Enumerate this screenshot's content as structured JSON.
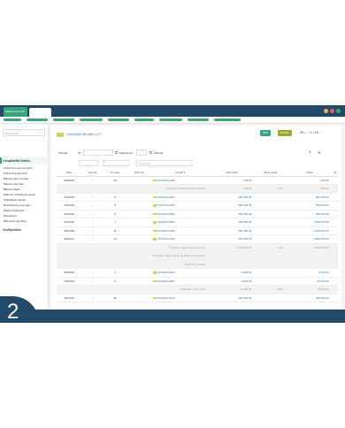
{
  "window": {
    "tab_label": "Tableau de bord",
    "dot_colors": [
      "#e8b64c",
      "#e55e5e",
      "#3aa57a"
    ]
  },
  "menu": {
    "pill_color": "#3aa57a"
  },
  "sidebar": {
    "search_placeholder": "Rechercher",
    "search_clear": "×",
    "section_accounting": "Comptabilité Détailé...",
    "items": [
      "Grand livre des comptes",
      "Grand livre des tiers",
      "Balance des comptes",
      "Balance des tiers",
      "Balance Agée",
      "Etats de contrôle de caisse",
      "Statistiques clients",
      "Brouillard des journaux",
      "Rapport d'activité",
      "Echéancier",
      "Bilan actif reporting"
    ],
    "section_config": "Configuration"
  },
  "header": {
    "title": "Grand livre des tiers",
    "count": "(437)",
    "pdf": "PDF",
    "excel": "EXCEL",
    "per_page": "25 ⌄",
    "page": "1",
    "of": "/ 19",
    "prev": "‹",
    "next": "›"
  },
  "filters": {
    "period_label": "Période",
    "from_label": "Du",
    "lettered_from": "Marqué Au",
    "lettered": "Marqué",
    "search_icon": "search-icon",
    "reset_icon": "reset-icon",
    "select_placeholder": "Selectionner"
  },
  "table": {
    "headers": [
      "Date",
      "Journal",
      "N° pièce",
      "Num Tie",
      "Libellé ▾",
      "Mvts débit",
      "Mvts crédit",
      "Solde",
      "⊞"
    ],
    "rows": [
      {
        "type": "row",
        "date": "09/02/22",
        "journal": "–",
        "piece": "30",
        "tie": "",
        "lib": "FAV2202-0016",
        "debit": "100,00",
        "credit": "",
        "solde": "100,00"
      },
      {
        "type": "total",
        "label": "Total Pour: Gamberie Cap France",
        "debit": "100,00",
        "credit": "0,00",
        "solde": "100,00"
      },
      {
        "type": "row",
        "date": "10/11/20",
        "journal": "–",
        "piece": "4",
        "tie": "",
        "lib": "FAV2011-0004",
        "debit": "500 000,00",
        "credit": "",
        "solde": "500 000,00"
      },
      {
        "type": "row",
        "date": "19/11/20",
        "journal": "–",
        "piece": "5",
        "tie": "",
        "lib": "FAV2011-0005",
        "debit": "500 000,00",
        "credit": "",
        "solde": "500 000,00"
      },
      {
        "type": "row",
        "date": "20/11/20",
        "journal": "–",
        "piece": "6",
        "tie": "",
        "lib": "FAV2011-0006",
        "debit": "500 000,00",
        "credit": "",
        "solde": "500 000,00"
      },
      {
        "type": "row",
        "date": "23/11/20",
        "journal": "–",
        "piece": "7",
        "tie": "",
        "lib": "FAV2011-0007",
        "debit": "500 000,00",
        "credit": "",
        "solde": "1 200 000,00"
      },
      {
        "type": "row",
        "date": "28/12/20",
        "journal": "–",
        "piece": "11",
        "tie": "",
        "lib": "FAV2012-0011",
        "debit": "500 000,00",
        "credit": "",
        "solde": "1 500 000,00"
      },
      {
        "type": "row",
        "date": "01/02/21",
        "journal": "–",
        "piece": "14",
        "tie": "",
        "lib": "FAV2102-0012",
        "debit": "500 000,00",
        "credit": "",
        "solde": "1 800 000,00"
      },
      {
        "type": "total",
        "label": "Total Pour: Marc-Steve Antoine",
        "debit": "1 700 010,00",
        "credit": "0,00",
        "solde": "1 800 000,00"
      },
      {
        "type": "total",
        "label": "Total Pour: Geffi, Camping Etoile de Casa Ho",
        "debit": "",
        "credit": "",
        "solde": ""
      },
      {
        "type": "total",
        "label": "Total Pour: Jonas",
        "debit": "",
        "credit": "",
        "solde": ""
      },
      {
        "type": "row",
        "date": "03/02/22",
        "journal": "–",
        "piece": "1",
        "tie": "",
        "lib": "FAV2202-0001",
        "debit": "5 000,00",
        "credit": "",
        "solde": "5 000,00"
      },
      {
        "type": "row",
        "date": "27/02/22",
        "journal": "–",
        "piece": "1",
        "tie": "",
        "lib": "FAV2202-0001",
        "debit": "6 000,00",
        "credit": "",
        "solde": "10 000,00"
      },
      {
        "type": "total",
        "label": "Total Pour: Auto Tiers",
        "debit": "11 000,00",
        "credit": "0,00",
        "solde": "10 000,00"
      },
      {
        "type": "row",
        "date": "15/12/21",
        "journal": "–",
        "piece": "26",
        "tie": "",
        "lib": "FAV2112-0014",
        "debit": "400 000,00",
        "credit": "",
        "solde": "400 000,00"
      }
    ]
  },
  "badge": {
    "number": "2"
  }
}
